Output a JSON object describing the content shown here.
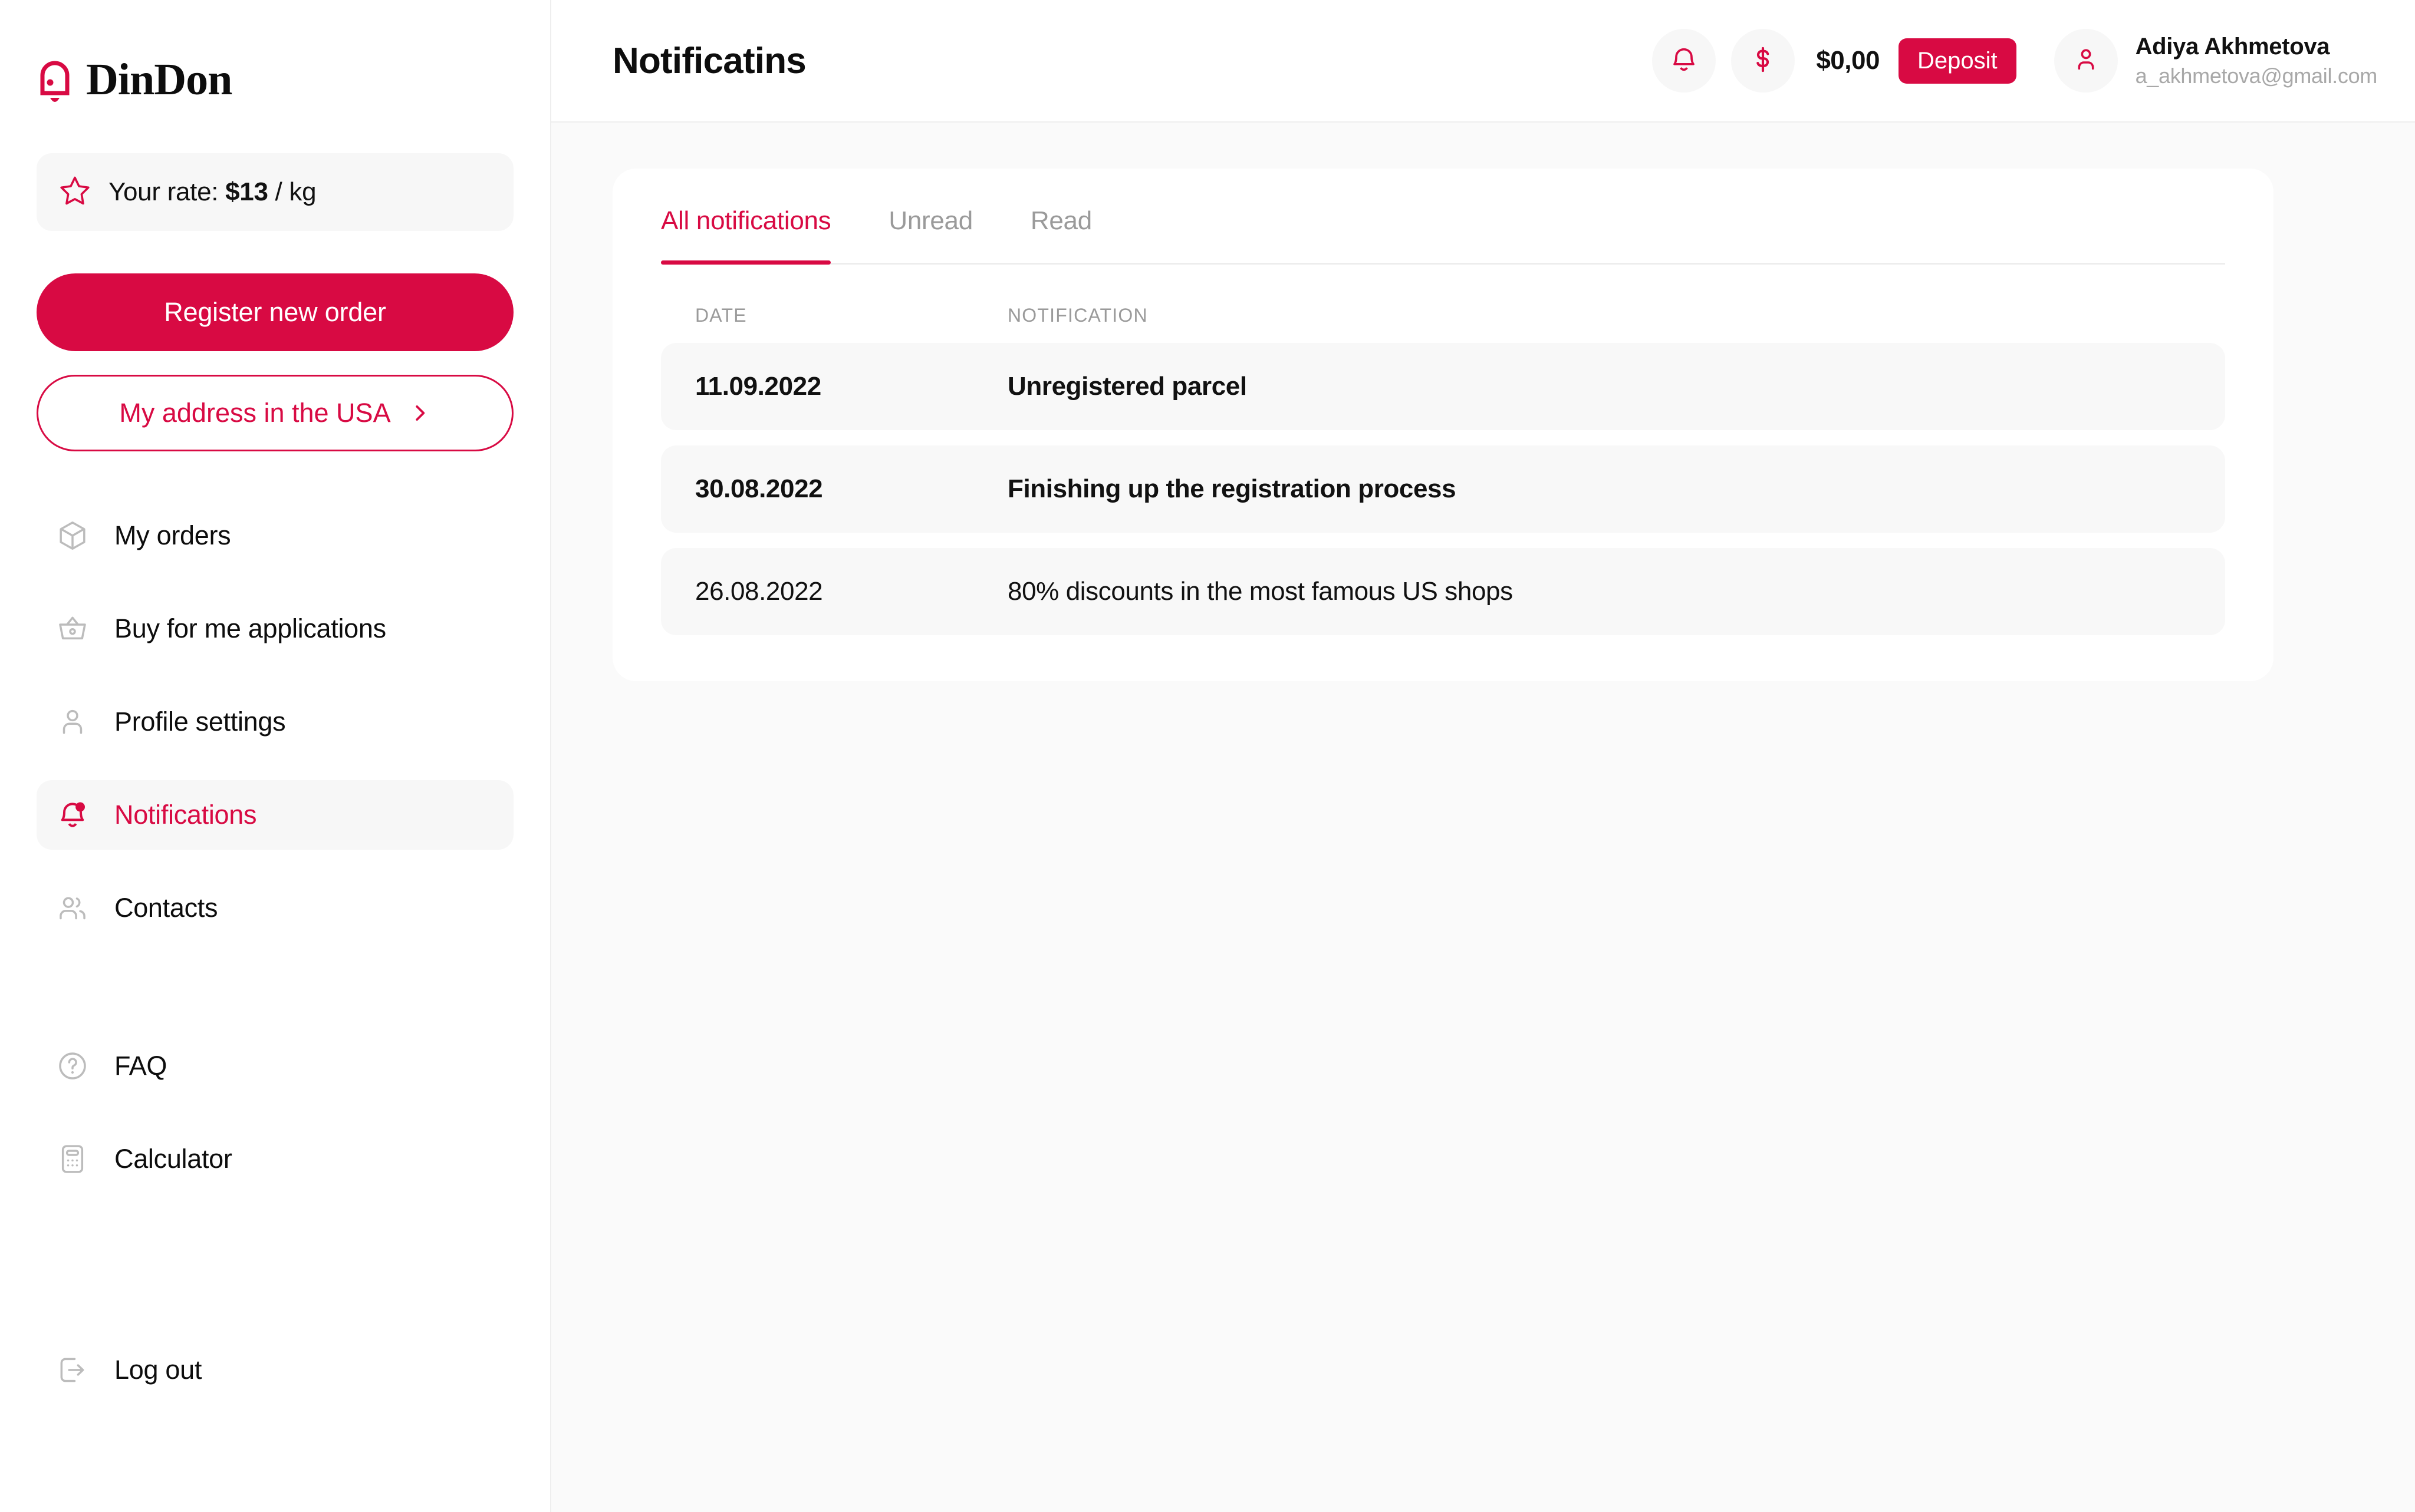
{
  "brand": {
    "name": "DinDon",
    "logo_icon": "bell-icon",
    "color": "#d80a43"
  },
  "sidebar": {
    "rate": {
      "icon": "star-icon",
      "label": "Your rate: ",
      "value": "$13",
      "unit": " / kg"
    },
    "primary_button": {
      "label": "Register new order"
    },
    "secondary_button": {
      "label": "My address in the USA",
      "icon": "chevron-right-icon"
    },
    "items": [
      {
        "label": "My orders",
        "icon": "box-icon",
        "active": false
      },
      {
        "label": "Buy for me applications",
        "icon": "basket-icon",
        "active": false
      },
      {
        "label": "Profile settings",
        "icon": "user-icon",
        "active": false
      },
      {
        "label": "Notifications",
        "icon": "bell-icon",
        "active": true
      },
      {
        "label": "Contacts",
        "icon": "users-icon",
        "active": false
      },
      {
        "label": "FAQ",
        "icon": "question-circle-icon",
        "active": false
      },
      {
        "label": "Calculator",
        "icon": "calculator-icon",
        "active": false
      },
      {
        "label": "Log out",
        "icon": "logout-icon",
        "active": false
      }
    ]
  },
  "header": {
    "title": "Notificatins",
    "notifications_icon": "bell-icon",
    "balance_icon": "dollar-icon",
    "balance": "$0,00",
    "deposit_label": "Deposit",
    "avatar_icon": "user-icon",
    "user_name": "Adiya Akhmetova",
    "user_email": "a_akhmetova@gmail.com"
  },
  "main": {
    "tabs": [
      {
        "label": "All notifications",
        "active": true
      },
      {
        "label": "Unread",
        "active": false
      },
      {
        "label": "Read",
        "active": false
      }
    ],
    "columns": {
      "date": "DATE",
      "notification": "NOTIFICATION"
    },
    "rows": [
      {
        "date": "11.09.2022",
        "text": "Unregistered parcel",
        "unread": true
      },
      {
        "date": "30.08.2022",
        "text": "Finishing up the registration process",
        "unread": true
      },
      {
        "date": "26.08.2022",
        "text": "80% discounts in the most famous US shops",
        "unread": false
      }
    ]
  }
}
